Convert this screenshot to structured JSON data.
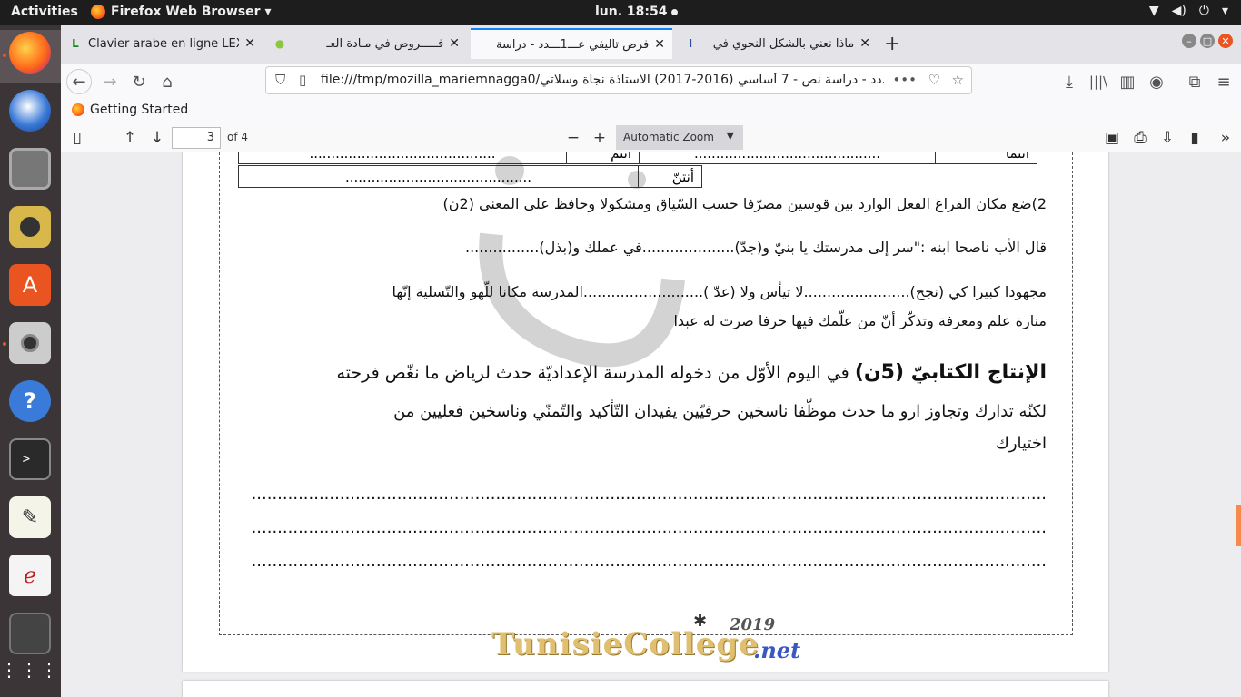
{
  "topbar": {
    "activities": "Activities",
    "app_menu": "Firefox Web Browser ▾",
    "clock": "lun. 18:54",
    "icons": [
      "network-icon",
      "volume-icon",
      "power-icon",
      "menu-caret-icon"
    ]
  },
  "dock": {
    "items": [
      "firefox",
      "thunderbird",
      "files",
      "rhythmbox",
      "ubuntu-software",
      "cheese-camera",
      "help",
      "terminal",
      "text-editor",
      "libreoffice",
      "disk",
      "app-grid"
    ]
  },
  "tabs": [
    {
      "title": "Clavier arabe en ligne LEXI",
      "fav_color": "#1a8a1a",
      "fav_glyph": "L"
    },
    {
      "title": "فـــــروض في مـادة العـ",
      "fav_color": "#8cc63e",
      "fav_glyph": "●"
    },
    {
      "title": "فرض تأليفي عـــ1ـــدد - دراسة",
      "fav_color": "#888888",
      "fav_glyph": ""
    },
    {
      "title": "ماذا نعني بالشكل النحوي في",
      "fav_color": "#2a4aa0",
      "fav_glyph": "ا"
    }
  ],
  "navbar": {
    "url_title": "...دد - دراسة نص - 7 أساسي (2016-2017) الاستاذة نجاة وسلاتي",
    "url_path": "file:///tmp/mozilla_mariemnagga0/",
    "more": "•••"
  },
  "bookmarks": {
    "getting_started": "Getting Started"
  },
  "pdf_toolbar": {
    "page_number": "3",
    "page_count": "of 4",
    "zoom": "Automatic Zoom"
  },
  "document": {
    "table_row1": {
      "c1": "أنتما",
      "c2": "...........................................",
      "c3": "أنتم",
      "c4": "..........................................."
    },
    "table_row2": {
      "c1": "أنتنّ",
      "c2": "..........................................."
    },
    "q2_title": "2)ضع مكان الفراغ الفعل الوارد بين قوسين مصرّفا حسب السّياق ومشكولا وحافظ على المعنى (2ن)",
    "q2_line1": "قال الأب ناصحا ابنه :\"سر إلى مدرستك يا بنيّ و(جدّ)....................في عملك و(بذل)................",
    "q2_line2": "مجهودا كبيرا كي (نجح).......................لا تيأس ولا (عدّ )..........................المدرسة مكانا للّهو والتّسلية إنّها",
    "q2_line3": "منارة علم ومعرفة وتذكّر أنّ من علّمك فيها حرفا صرت له عبدا",
    "prod_heading": "الإنتاج الكتابيّ (5ن)",
    "prod_line1": "في اليوم الأوّل من دخوله المدرسة الإعداديّة حدث لرياض ما نغّص فرحته",
    "prod_line2": "لكنّه تدارك وتجاوز ارو ما حدث موظّفا ناسخين حرفيّين يفيدان التّأكيد والتّمنّي وناسخين فعليين من",
    "prod_line3": "اختيارك",
    "dots": ".................................................................................................................................................................."
  },
  "logo": {
    "year": "2019",
    "name": "TunisieCollege",
    "tld": ".net",
    "colors": {
      "gold": "#e0c070",
      "blue": "#3a58c0"
    }
  }
}
